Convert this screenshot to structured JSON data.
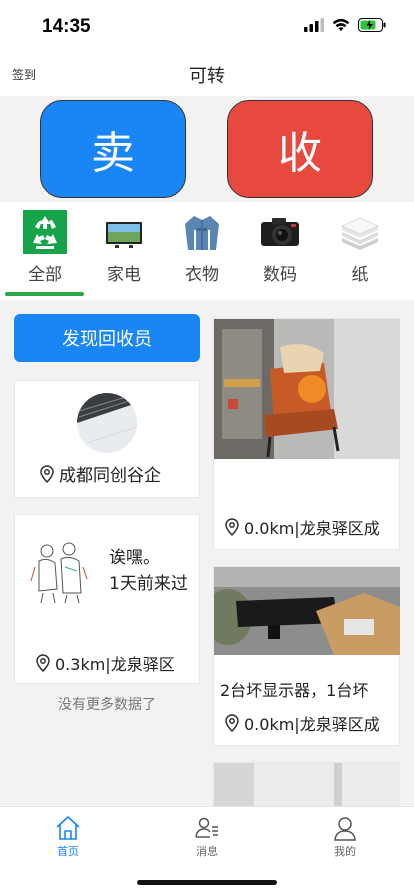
{
  "status": {
    "time": "14:35"
  },
  "nav": {
    "left": "签到",
    "title": "可转"
  },
  "actions": {
    "sell": "卖",
    "buy": "收"
  },
  "categories": [
    {
      "label": "全部",
      "icon": "recycle-icon",
      "active": true
    },
    {
      "label": "家电",
      "icon": "tv-icon"
    },
    {
      "label": "衣物",
      "icon": "jacket-icon"
    },
    {
      "label": "数码",
      "icon": "camera-icon"
    },
    {
      "label": "纸",
      "icon": "paper-stack-icon"
    }
  ],
  "left_column": {
    "find_button": "发现回收员",
    "card_a": {
      "location": "成都同创谷企"
    },
    "card_b": {
      "line1": "诶嘿。",
      "line2": "1天前来过",
      "location": "0.3km|龙泉驿区"
    },
    "no_more": "没有更多数据了"
  },
  "right_column": {
    "card1": {
      "location": "0.0km|龙泉驿区成"
    },
    "card2": {
      "title": "2台坏显示器，1台坏",
      "location": "0.0km|龙泉驿区成"
    }
  },
  "tabbar": [
    {
      "label": "首页",
      "icon": "home-icon",
      "active": true
    },
    {
      "label": "消息",
      "icon": "message-icon"
    },
    {
      "label": "我的",
      "icon": "user-icon"
    }
  ],
  "colors": {
    "accent": "#1a85f5",
    "sell": "#1a85f5",
    "buy": "#e8493f",
    "tab_underline": "#2aa84a"
  }
}
